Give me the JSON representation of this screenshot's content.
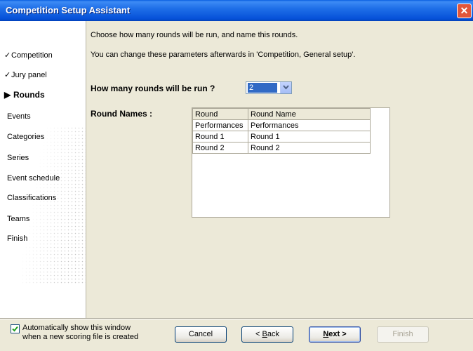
{
  "window": {
    "title": "Competition Setup Assistant",
    "close_glyph": "✕"
  },
  "sidebar": {
    "steps": [
      {
        "label": "Competition",
        "state": "done",
        "mark": "✓"
      },
      {
        "label": "Jury panel",
        "state": "done",
        "mark": "✓"
      },
      {
        "label": "Rounds",
        "state": "current",
        "mark": "▶"
      },
      {
        "label": "Events",
        "state": "todo",
        "mark": ""
      },
      {
        "label": "Categories",
        "state": "todo",
        "mark": ""
      },
      {
        "label": "Series",
        "state": "todo",
        "mark": ""
      },
      {
        "label": "Event schedule",
        "state": "todo",
        "mark": ""
      },
      {
        "label": "Classifications",
        "state": "todo",
        "mark": ""
      },
      {
        "label": "Teams",
        "state": "todo",
        "mark": ""
      },
      {
        "label": "Finish",
        "state": "todo",
        "mark": ""
      }
    ]
  },
  "main": {
    "intro": "Choose how many rounds will be run, and name this rounds.",
    "note": "You can change these parameters afterwards in 'Competition, General setup'.",
    "rounds_question": "How many rounds will be run ?",
    "rounds_count": "2",
    "round_names_label": "Round Names :",
    "grid": {
      "headers": [
        "Round",
        "Round Name"
      ],
      "rows": [
        [
          "Performances",
          "Performances"
        ],
        [
          "Round 1",
          "Round 1"
        ],
        [
          "Round 2",
          "Round 2"
        ]
      ]
    }
  },
  "footer": {
    "auto_show_checked": true,
    "auto_show_line1": "Automatically show this window",
    "auto_show_line2": "when a new scoring file is created",
    "cancel": "Cancel",
    "back_prefix": "< ",
    "back_key": "B",
    "back_rest": "ack",
    "next_key": "N",
    "next_rest": "ext >",
    "finish": "Finish"
  },
  "colors": {
    "title_bar": "#1F6FE8",
    "selection": "#316AC5",
    "dialog_bg": "#ECE9D8"
  }
}
